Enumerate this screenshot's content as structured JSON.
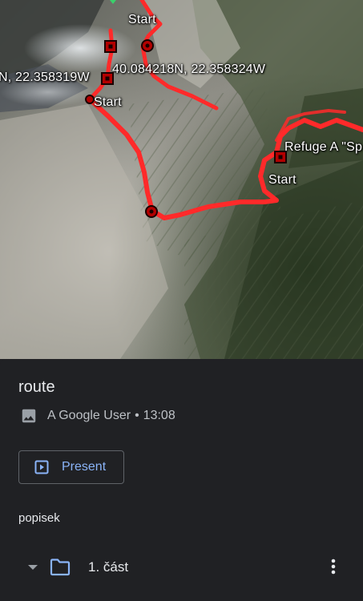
{
  "map": {
    "labels": {
      "start_top": "Start",
      "coord_right": "40.084218N, 22.358324W",
      "coord_left": "N, 22.358319W",
      "start_left": "Start",
      "refuge": "Refuge A \"Sp",
      "start_right": "Start"
    },
    "route_color": "#ff2a2a"
  },
  "sheet": {
    "title": "route",
    "author": "A Google User",
    "separator": "•",
    "time": "13:08",
    "present_label": "Present",
    "description": "popisek",
    "folder_label": "1. část"
  },
  "icons": {
    "image": "image-icon",
    "present": "present-icon",
    "caret": "caret-down-icon",
    "folder": "folder-icon",
    "more": "more-vert-icon"
  },
  "colors": {
    "sheet_bg": "#202124",
    "accent": "#8ab4f8",
    "text": "#e8eaed",
    "muted": "#bdc1c6"
  }
}
